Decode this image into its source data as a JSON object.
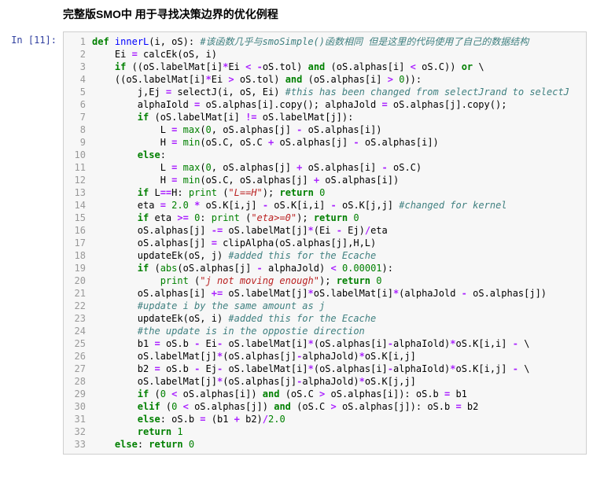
{
  "title": "完整版SMO中 用于寻找决策边界的优化例程",
  "prompt": "In [11]:",
  "line_count": 33,
  "code_lines": [
    "<span class='kw'>def</span> <span class='nf'>innerL</span>(i, oS): <span class='cmt'>#该函数几乎与smoSimple()函数相同 但是这里的代码使用了自己的数据结构</span>",
    "    Ei <span class='op'>=</span> calcEk(oS, i)",
    "    <span class='kw'>if</span> ((oS.labelMat[i]<span class='op'>*</span>Ei <span class='op'>&lt;</span> <span class='op'>-</span>oS.tol) <span class='kw'>and</span> (oS.alphas[i] <span class='op'>&lt;</span> oS.C)) <span class='kw'>or</span> \\",
    "    ((oS.labelMat[i]<span class='op'>*</span>Ei <span class='op'>&gt;</span> oS.tol) <span class='kw'>and</span> (oS.alphas[i] <span class='op'>&gt;</span> <span class='num'>0</span>)):",
    "        j,Ej <span class='op'>=</span> selectJ(i, oS, Ei) <span class='cmt'>#this has been changed from selectJrand to selectJ</span>",
    "        alphaIold <span class='op'>=</span> oS.alphas[i].copy(); alphaJold <span class='op'>=</span> oS.alphas[j].copy();",
    "        <span class='kw'>if</span> (oS.labelMat[i] <span class='op'>!=</span> oS.labelMat[j]):",
    "            L <span class='op'>=</span> <span class='bi'>max</span>(<span class='num'>0</span>, oS.alphas[j] <span class='op'>-</span> oS.alphas[i])",
    "            H <span class='op'>=</span> <span class='bi'>min</span>(oS.C, oS.C <span class='op'>+</span> oS.alphas[j] <span class='op'>-</span> oS.alphas[i])",
    "        <span class='kw'>else</span>:",
    "            L <span class='op'>=</span> <span class='bi'>max</span>(<span class='num'>0</span>, oS.alphas[j] <span class='op'>+</span> oS.alphas[i] <span class='op'>-</span> oS.C)",
    "            H <span class='op'>=</span> <span class='bi'>min</span>(oS.C, oS.alphas[j] <span class='op'>+</span> oS.alphas[i])",
    "        <span class='kw'>if</span> L<span class='op'>==</span>H: <span class='bi'>print</span> (<span class='str'>\"L==H\"</span>); <span class='kw'>return</span> <span class='num'>0</span>",
    "        eta <span class='op'>=</span> <span class='num'>2.0</span> <span class='op'>*</span> oS.K[i,j] <span class='op'>-</span> oS.K[i,i] <span class='op'>-</span> oS.K[j,j] <span class='cmt'>#changed for kernel</span>",
    "        <span class='kw'>if</span> eta <span class='op'>&gt;=</span> <span class='num'>0</span>: <span class='bi'>print</span> (<span class='str'>\"eta&gt;=0\"</span>); <span class='kw'>return</span> <span class='num'>0</span>",
    "        oS.alphas[j] <span class='op'>-=</span> oS.labelMat[j]<span class='op'>*</span>(Ei <span class='op'>-</span> Ej)<span class='op'>/</span>eta",
    "        oS.alphas[j] <span class='op'>=</span> clipAlpha(oS.alphas[j],H,L)",
    "        updateEk(oS, j) <span class='cmt'>#added this for the Ecache</span>",
    "        <span class='kw'>if</span> (<span class='bi'>abs</span>(oS.alphas[j] <span class='op'>-</span> alphaJold) <span class='op'>&lt;</span> <span class='num'>0.00001</span>):",
    "            <span class='bi'>print</span> (<span class='str'>\"j not moving enough\"</span>); <span class='kw'>return</span> <span class='num'>0</span>",
    "        oS.alphas[i] <span class='op'>+=</span> oS.labelMat[j]<span class='op'>*</span>oS.labelMat[i]<span class='op'>*</span>(alphaJold <span class='op'>-</span> oS.alphas[j])",
    "        <span class='cmt'>#update i by the same amount as j</span>",
    "        updateEk(oS, i) <span class='cmt'>#added this for the Ecache</span>",
    "        <span class='cmt'>#the update is in the oppostie direction</span>",
    "        b1 <span class='op'>=</span> oS.b <span class='op'>-</span> Ei<span class='op'>-</span> oS.labelMat[i]<span class='op'>*</span>(oS.alphas[i]<span class='op'>-</span>alphaIold)<span class='op'>*</span>oS.K[i,i] <span class='op'>-</span> \\",
    "        oS.labelMat[j]<span class='op'>*</span>(oS.alphas[j]<span class='op'>-</span>alphaJold)<span class='op'>*</span>oS.K[i,j]",
    "        b2 <span class='op'>=</span> oS.b <span class='op'>-</span> Ej<span class='op'>-</span> oS.labelMat[i]<span class='op'>*</span>(oS.alphas[i]<span class='op'>-</span>alphaIold)<span class='op'>*</span>oS.K[i,j] <span class='op'>-</span> \\",
    "        oS.labelMat[j]<span class='op'>*</span>(oS.alphas[j]<span class='op'>-</span>alphaJold)<span class='op'>*</span>oS.K[j,j]",
    "        <span class='kw'>if</span> (<span class='num'>0</span> <span class='op'>&lt;</span> oS.alphas[i]) <span class='kw'>and</span> (oS.C <span class='op'>&gt;</span> oS.alphas[i]): oS.b <span class='op'>=</span> b1",
    "        <span class='kw'>elif</span> (<span class='num'>0</span> <span class='op'>&lt;</span> oS.alphas[j]) <span class='kw'>and</span> (oS.C <span class='op'>&gt;</span> oS.alphas[j]): oS.b <span class='op'>=</span> b2",
    "        <span class='kw'>else</span>: oS.b <span class='op'>=</span> (b1 <span class='op'>+</span> b2)<span class='op'>/</span><span class='num'>2.0</span>",
    "        <span class='kw'>return</span> <span class='num'>1</span>",
    "    <span class='kw'>else</span>: <span class='kw'>return</span> <span class='num'>0</span>"
  ]
}
